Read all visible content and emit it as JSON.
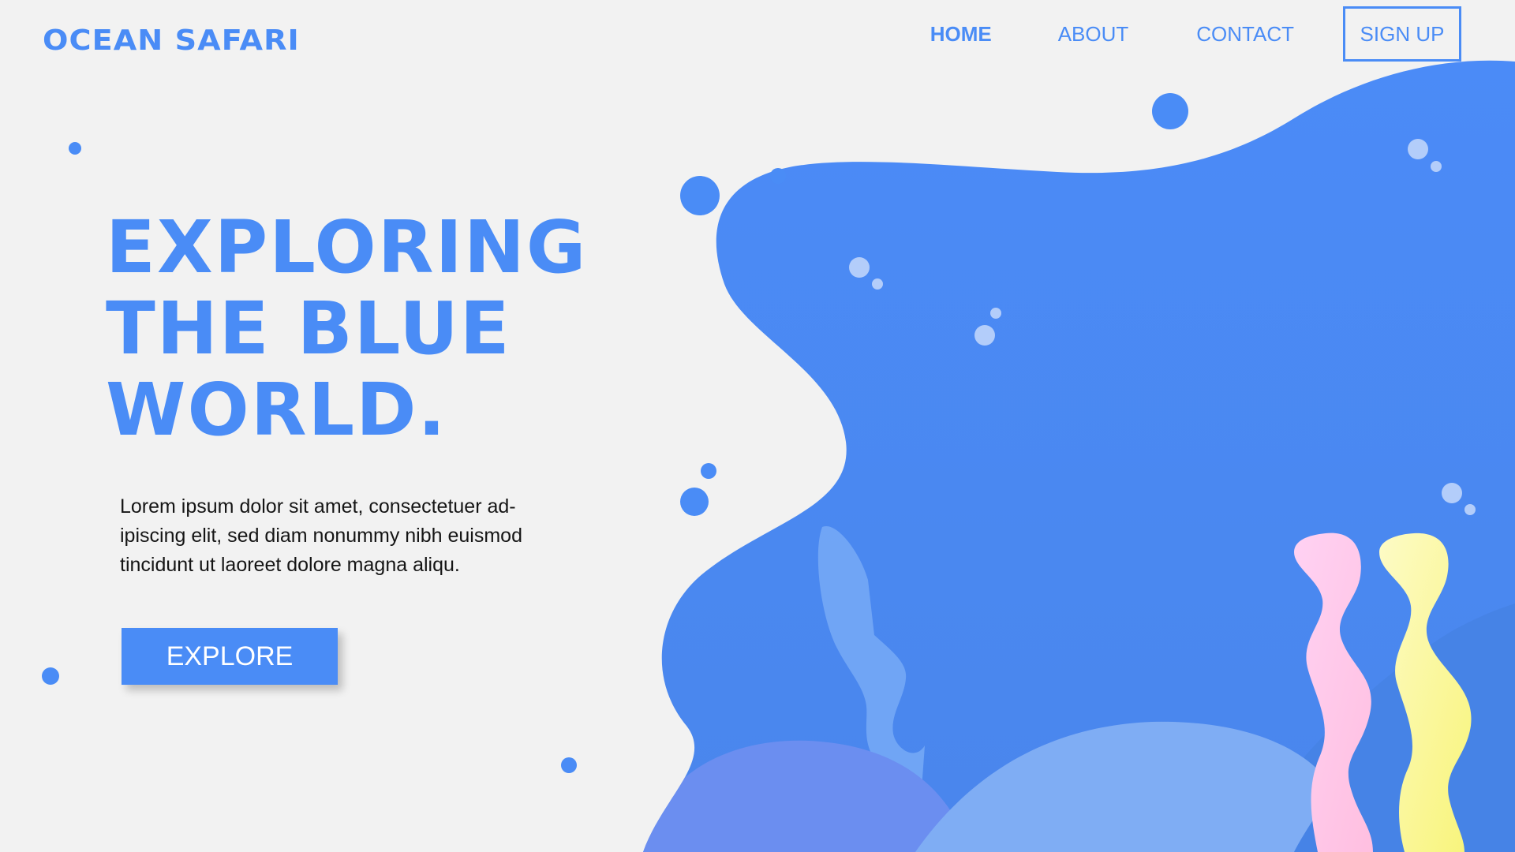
{
  "brand": {
    "name": "OCEAN SAFARI"
  },
  "nav": {
    "items": [
      {
        "label": "HOME",
        "active": true
      },
      {
        "label": "ABOUT",
        "active": false
      },
      {
        "label": "CONTACT",
        "active": false
      }
    ],
    "signup_label": "SIGN UP"
  },
  "hero": {
    "title_lines": [
      "EXPLORING",
      "THE BLUE",
      "WORLD."
    ],
    "body": "Lorem ipsum dolor sit amet, consectetuer ad-ipiscing elit, sed diam nonummy nibh euismod tincidunt ut laoreet dolore magna aliqu.",
    "button_label": "EXPLORE"
  },
  "colors": {
    "accent": "#4a8cf6",
    "background": "#f2f2f2",
    "coral_pink": "#ffc9ec",
    "coral_yellow": "#fbf59a"
  }
}
